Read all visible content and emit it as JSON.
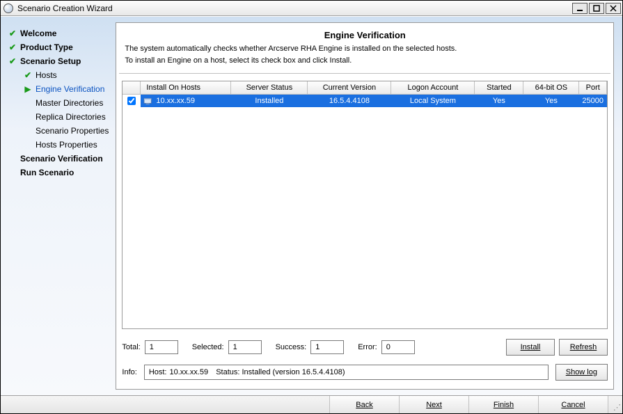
{
  "window": {
    "title": "Scenario Creation Wizard"
  },
  "nav": {
    "welcome": "Welcome",
    "product_type": "Product Type",
    "scenario_setup": "Scenario Setup",
    "hosts": "Hosts",
    "engine_verification": "Engine Verification",
    "master_directories": "Master Directories",
    "replica_directories": "Replica Directories",
    "scenario_properties": "Scenario Properties",
    "hosts_properties": "Hosts Properties",
    "scenario_verification": "Scenario Verification",
    "run_scenario": "Run Scenario"
  },
  "page": {
    "title": "Engine Verification",
    "desc1": "The system automatically checks whether Arcserve RHA Engine is installed on the selected hosts.",
    "desc2": "To install an Engine on a host, select its check box and click Install."
  },
  "grid": {
    "headers": {
      "install_on_hosts": "Install On Hosts",
      "server_status": "Server Status",
      "current_version": "Current Version",
      "logon_account": "Logon Account",
      "started": "Started",
      "os64": "64-bit OS",
      "port": "Port"
    },
    "rows": [
      {
        "checked": true,
        "host": "10.xx.xx.59",
        "server_status": "Installed",
        "current_version": "16.5.4.4108",
        "logon_account": "Local System",
        "started": "Yes",
        "os64": "Yes",
        "port": "25000"
      }
    ]
  },
  "counters": {
    "total_label": "Total:",
    "total_value": "1",
    "selected_label": "Selected:",
    "selected_value": "1",
    "success_label": "Success:",
    "success_value": "1",
    "error_label": "Error:",
    "error_value": "0"
  },
  "buttons": {
    "install": "Install",
    "refresh": "Refresh",
    "show_log": "Show log"
  },
  "info": {
    "label": "Info:",
    "host_label": "Host:",
    "host_value": "10.xx.xx.59",
    "status_text": "Status: Installed (version 16.5.4.4108)"
  },
  "footer": {
    "back": "Back",
    "next": "Next",
    "finish": "Finish",
    "cancel": "Cancel"
  }
}
